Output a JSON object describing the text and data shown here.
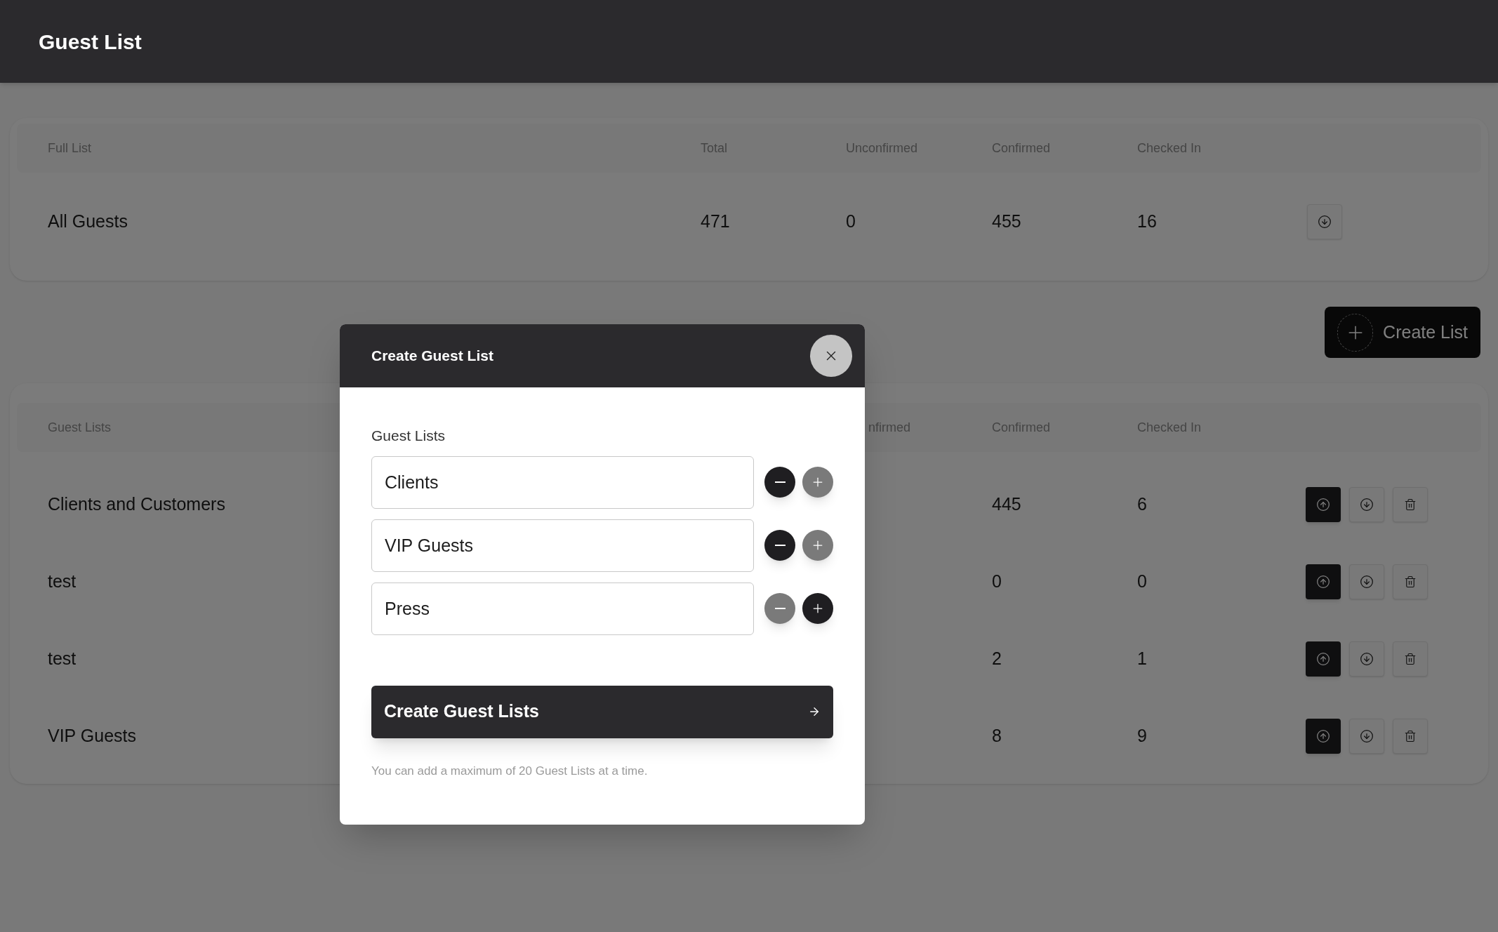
{
  "header": {
    "title": "Guest List"
  },
  "full_list": {
    "columns": [
      "Full List",
      "Total",
      "Unconfirmed",
      "Confirmed",
      "Checked In"
    ],
    "rows": [
      {
        "name": "All Guests",
        "total": "471",
        "unconfirmed": "0",
        "confirmed": "455",
        "checked_in": "16"
      }
    ]
  },
  "create_list_button": {
    "label": "Create List"
  },
  "guest_lists": {
    "columns": [
      "Guest Lists",
      "nfirmed",
      "Confirmed",
      "Checked In"
    ],
    "rows": [
      {
        "name": "Clients and Customers",
        "confirmed": "445",
        "checked_in": "6"
      },
      {
        "name": "test",
        "confirmed": "0",
        "checked_in": "0"
      },
      {
        "name": "test",
        "confirmed": "2",
        "checked_in": "1"
      },
      {
        "name": "VIP Guests",
        "confirmed": "8",
        "checked_in": "9"
      }
    ]
  },
  "dialog": {
    "title": "Create Guest List",
    "field_label": "Guest Lists",
    "entries": [
      {
        "value": "Clients",
        "remove_disabled": false,
        "add_disabled": true
      },
      {
        "value": "VIP Guests",
        "remove_disabled": false,
        "add_disabled": true
      },
      {
        "value": "Press",
        "remove_disabled": true,
        "add_disabled": false
      }
    ],
    "submit": "Create Guest Lists",
    "hint": "You can add a maximum of 20 Guest Lists at a time."
  }
}
